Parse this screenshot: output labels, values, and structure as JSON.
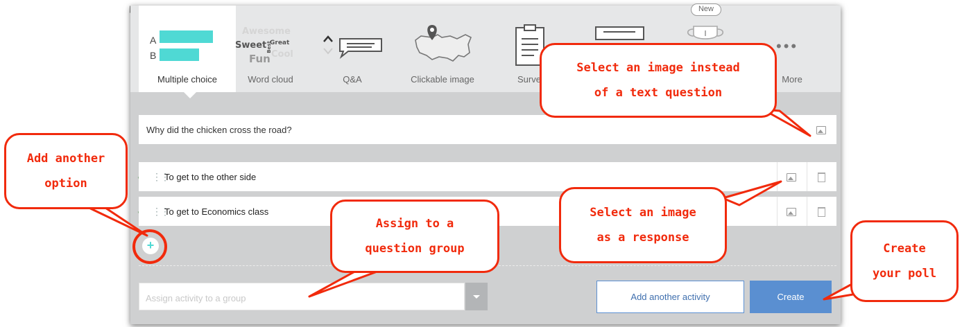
{
  "tabs": [
    {
      "label": "Multiple choice",
      "active": true
    },
    {
      "label": "Word cloud",
      "active": false
    },
    {
      "label": "Q&A",
      "active": false
    },
    {
      "label": "Clickable image",
      "active": false
    },
    {
      "label": "Surve",
      "active": false
    },
    {
      "label": "More",
      "active": false
    }
  ],
  "multiple_choice_preview": {
    "row_a": "A",
    "row_b": "B"
  },
  "word_cloud_preview": {
    "w1": "Awesome",
    "w2": "Sweet",
    "w3": "Best",
    "w4": "Great",
    "w5": "Fun",
    "w6": "Cool"
  },
  "new_badge": "New",
  "question": {
    "text": "Why did the chicken cross the road?"
  },
  "options": [
    {
      "text": "To get to the other side"
    },
    {
      "text": "To get to Economics class"
    }
  ],
  "add_option_symbol": "+",
  "group": {
    "placeholder": "Assign activity to a group"
  },
  "buttons": {
    "add_another": "Add another activity",
    "create": "Create"
  },
  "callouts": {
    "image_question_l1": "Select an image instead",
    "image_question_l2": "of a text question",
    "add_option_l1": "Add another",
    "add_option_l2": "option",
    "assign_group_l1": "Assign to a",
    "assign_group_l2": "question group",
    "image_response_l1": "Select an image",
    "image_response_l2": "as a response",
    "create_poll_l1": "Create",
    "create_poll_l2": "your poll"
  },
  "colors": {
    "accent_teal": "#4fd9d4",
    "callout_red": "#f12a0c",
    "create_blue": "#5a8fd1"
  }
}
